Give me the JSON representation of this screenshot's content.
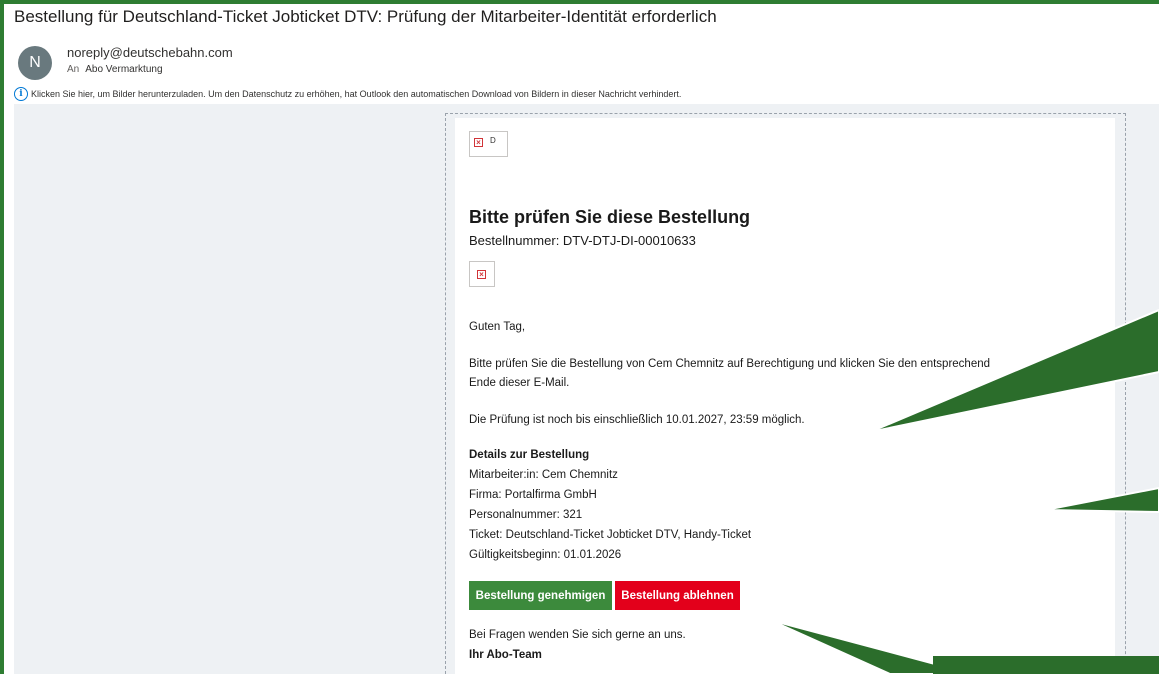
{
  "email": {
    "subject": "Bestellung für Deutschland-Ticket Jobticket DTV: Prüfung der Mitarbeiter-Identität erforderlich",
    "avatar_initial": "N",
    "sender": "noreply@deutschebahn.com",
    "to_prefix": "An",
    "recipient": "Abo Vermarktung",
    "info_bar": "Klicken Sie hier, um Bilder herunterzuladen. Um den Datenschutz zu erhöhen, hat Outlook den automatischen Download von Bildern in dieser Nachricht verhindert."
  },
  "message": {
    "logo_alt": "D",
    "heading": "Bitte prüfen Sie diese Bestellung",
    "order_number": "Bestellnummer: DTV-DTJ-DI-00010633",
    "greeting": "Guten Tag,",
    "instruction_line1": "Bitte prüfen Sie die Bestellung von Cem Chemnitz auf Berechtigung und klicken Sie den entsprechend",
    "instruction_line2": "Ende dieser E-Mail.",
    "deadline": "Die Prüfung ist noch bis einschließlich 10.01.2027, 23:59 möglich.",
    "details_title": "Details zur Bestellung",
    "details": [
      "Mitarbeiter:in: Cem Chemnitz",
      "Firma: Portalfirma GmbH",
      "Personalnummer: 321",
      "Ticket: Deutschland-Ticket Jobticket DTV, Handy-Ticket",
      "Gültigkeitsbeginn: 01.01.2026"
    ],
    "approve_button": "Bestellung genehmigen",
    "reject_button": "Bestellung ablehnen",
    "questions": "Bei Fragen wenden Sie sich gerne an uns.",
    "signature": "Ihr Abo-Team"
  },
  "colors": {
    "frame_green": "#2e7d32",
    "approve": "#3c8a3c",
    "reject": "#e3001b",
    "annotation_green": "#2b6d2b"
  }
}
